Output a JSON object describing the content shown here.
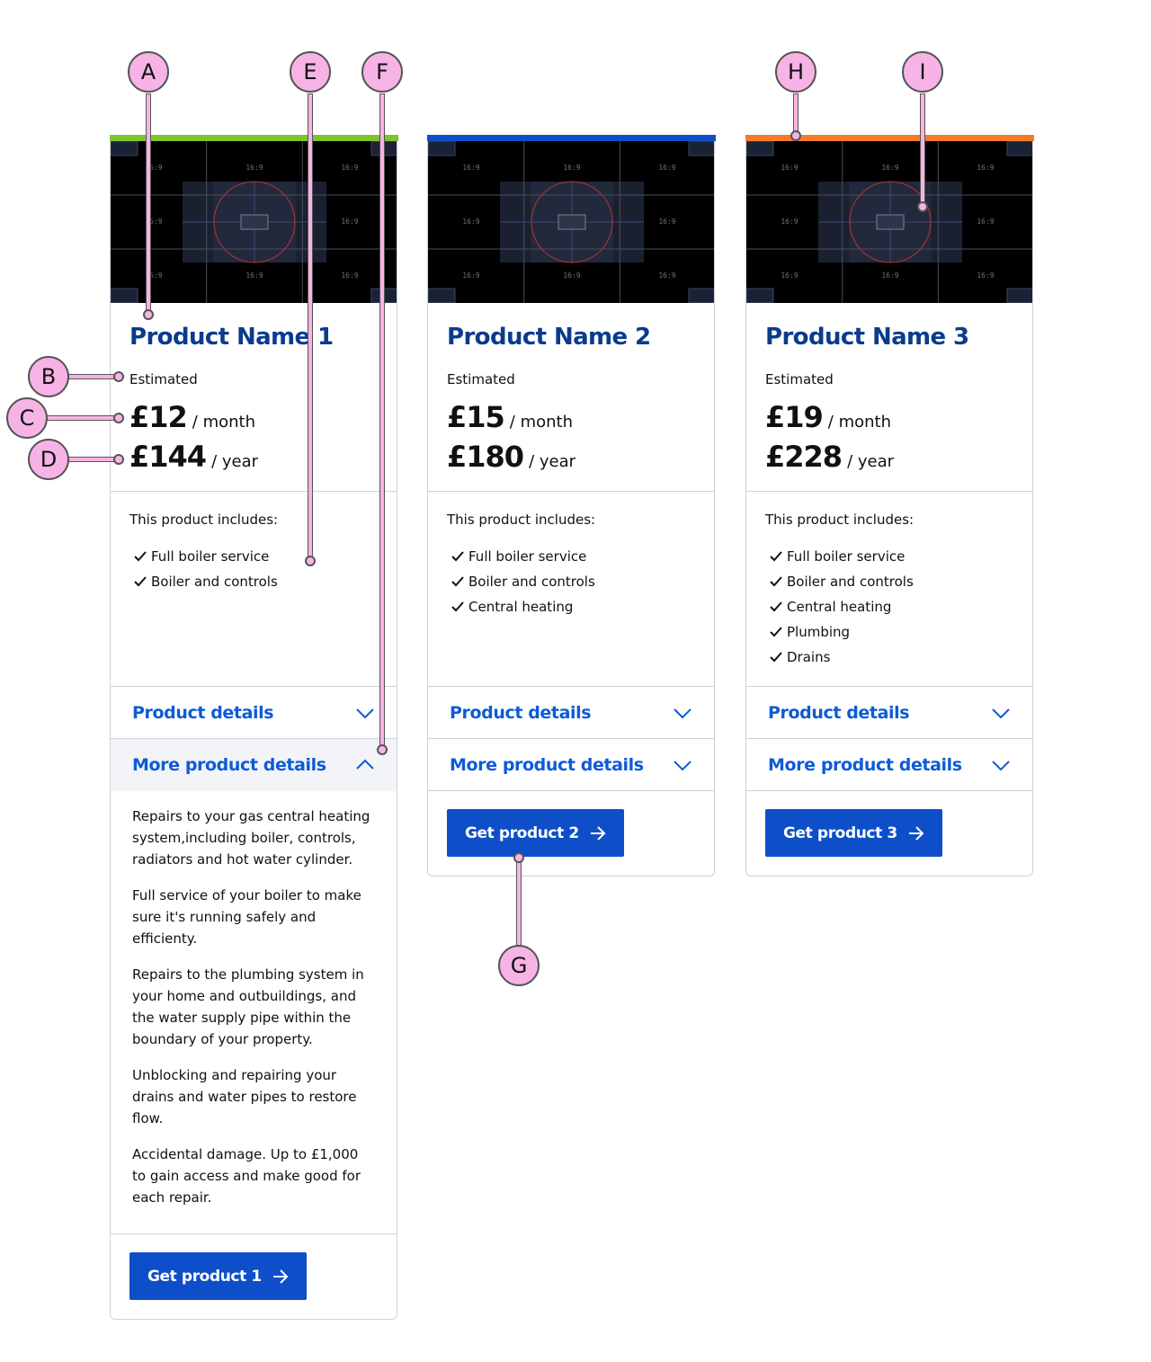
{
  "colors": {
    "card1_bar": "#7fc42e",
    "card2_bar": "#0e4fc9",
    "card3_bar": "#f47b2a",
    "link": "#0e5bd6",
    "title": "#0b3b8c",
    "annotation": "#f7b3e6"
  },
  "media": {
    "ratio_label": "16:9"
  },
  "cards": [
    {
      "name": "Product Name 1",
      "estimated": "Estimated",
      "monthly_amount": "£12",
      "monthly_unit": "/ month",
      "yearly_amount": "£144",
      "yearly_unit": "/ year",
      "includes_title": "This product includes:",
      "features": [
        "Full boiler service",
        "Boiler and controls"
      ],
      "accordion_1": "Product details",
      "accordion_2": "More product details",
      "details": [
        "Repairs to your gas central heating system,including boiler, controls, radiators and hot water cylinder.",
        "Full service of your boiler to make sure it's running safely and efficienty.",
        "Repairs to the plumbing system in your home and outbuildings, and the water supply pipe within the boundary of your property.",
        "Unblocking and repairing your drains and water pipes to restore flow.",
        "Accidental damage. Up to £1,000 to gain access and make good for each repair."
      ],
      "cta": "Get product 1"
    },
    {
      "name": "Product Name 2",
      "estimated": "Estimated",
      "monthly_amount": "£15",
      "monthly_unit": "/ month",
      "yearly_amount": "£180",
      "yearly_unit": "/ year",
      "includes_title": "This product includes:",
      "features": [
        "Full boiler service",
        "Boiler and controls",
        "Central heating"
      ],
      "accordion_1": "Product details",
      "accordion_2": "More product details",
      "cta": "Get product 2"
    },
    {
      "name": "Product Name 3",
      "estimated": "Estimated",
      "monthly_amount": "£19",
      "monthly_unit": "/ month",
      "yearly_amount": "£228",
      "yearly_unit": "/ year",
      "includes_title": "This product includes:",
      "features": [
        "Full boiler service",
        "Boiler and controls",
        "Central heating",
        "Plumbing",
        "Drains"
      ],
      "accordion_1": "Product details",
      "accordion_2": "More product details",
      "cta": "Get product 3"
    }
  ],
  "annotations": {
    "a": "A",
    "b": "B",
    "c": "C",
    "d": "D",
    "e": "E",
    "f": "F",
    "g": "G",
    "h": "H",
    "i": "I"
  }
}
